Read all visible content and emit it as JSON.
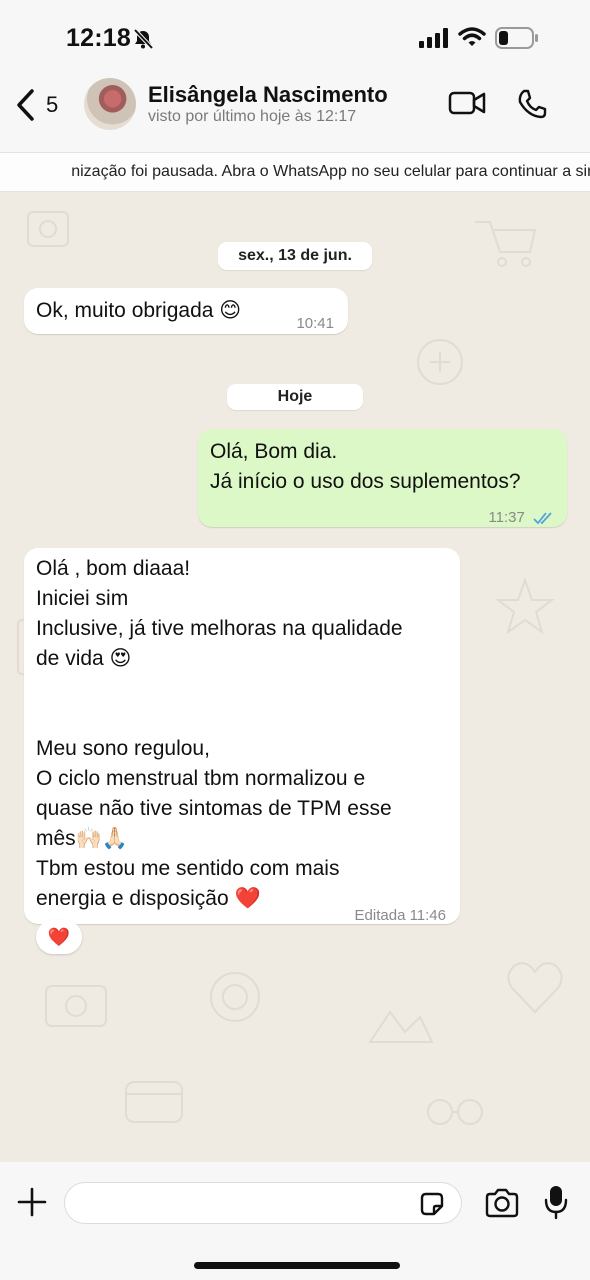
{
  "status_bar": {
    "time": "12:18",
    "icons": [
      "bell-slash-icon",
      "signal-icon",
      "wifi-icon",
      "battery-icon"
    ]
  },
  "header": {
    "back_count": "5",
    "contact_name": "Elisângela Nascimento",
    "contact_status": "visto por último hoje às 12:17",
    "icons": [
      "chevron-left-icon",
      "video-call-icon",
      "phone-icon"
    ]
  },
  "banner": {
    "text": "nização foi pausada. Abra o WhatsApp no seu celular para continuar a sin"
  },
  "chat": {
    "date_1": "sex., 13 de jun.",
    "date_2": "Hoje",
    "messages": [
      {
        "direction": "incoming",
        "lines": [
          "Ok, muito obrigada 😊"
        ],
        "time": "10:41"
      },
      {
        "direction": "outgoing",
        "lines": [
          "Olá, Bom dia.",
          "Já início o uso dos suplementos?"
        ],
        "time": "11:37",
        "status": "read"
      },
      {
        "direction": "incoming",
        "lines": [
          "Olá , bom diaaa!",
          "Iniciei sim",
          "Inclusive, já tive melhoras na qualidade",
          "de vida 😍",
          "",
          "",
          "Meu sono regulou,",
          "O ciclo menstrual tbm normalizou e",
          "quase não tive sintomas de TPM esse",
          "mês🙌🏻🙏🏻",
          "Tbm estou me sentido com mais",
          "energia e disposição ❤️"
        ],
        "time": "Editada 11:46",
        "reaction": "❤️"
      }
    ]
  },
  "input_bar": {
    "placeholder": "",
    "icons": [
      "plus-icon",
      "sticker-icon",
      "camera-icon",
      "microphone-icon"
    ]
  },
  "colors": {
    "outgoing_bubble": "#dcf8c6",
    "incoming_bubble": "#ffffff",
    "chat_background": "#efeae2",
    "read_ticks": "#4fa3e0"
  }
}
